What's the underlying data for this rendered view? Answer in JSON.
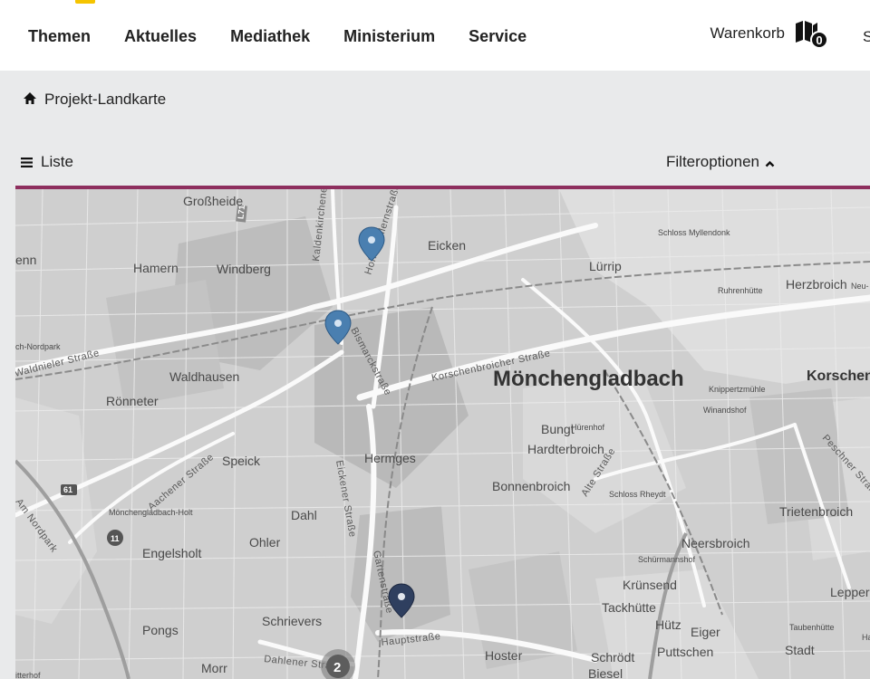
{
  "header": {
    "nav": [
      "Themen",
      "Aktuelles",
      "Mediathek",
      "Ministerium",
      "Service"
    ],
    "cart": {
      "label": "Warenkorb",
      "count": "0"
    },
    "cut_off_text": "S"
  },
  "breadcrumb": {
    "label": "Projekt-Landkarte"
  },
  "toolbar": {
    "list_label": "Liste",
    "filter_label": "Filteroptionen"
  },
  "colors": {
    "accent_line": "#8e2f5e",
    "marker_blue": "#4a7fb0",
    "marker_dark": "#2f3f5f",
    "page_bg": "#e9eaeb"
  },
  "map": {
    "city": "Mönchengladbach",
    "places": [
      "Großheide",
      "Eicken",
      "Hamern",
      "Windberg",
      "Lürrip",
      "Herzbroich",
      "Waldhausen",
      "Rönneter",
      "Bungt",
      "Hardterbroich",
      "Hermges",
      "Speick",
      "Bonnenbroich",
      "Dahl",
      "Ohler",
      "Engelsholt",
      "Trietenbroich",
      "Neersbroich",
      "Pongs",
      "Schrievers",
      "Tackhütte",
      "Hütz",
      "Eiger",
      "Krünsend",
      "Schrödt",
      "Puttschen",
      "Hoster",
      "Stadt",
      "Lepper",
      "Morr",
      "Biesel",
      "Korschen",
      "enn"
    ],
    "small_places": [
      "Schloss Myllendonk",
      "Ruhrenhütte",
      "Neu-",
      "Knippertzmühle",
      "Winandshof",
      "Hürenhof",
      "Schloss Rheydt",
      "Mönchengladbach-Holt",
      "Schürmannshof",
      "Taubenhütte",
      "Ha",
      "itterhof",
      "ch-Nordpark"
    ],
    "roads": [
      "Kaldenkirchener Straße",
      "Hohenzollernstraße",
      "Korschenbroicher Straße",
      "Waldnieler Straße",
      "Aachener Straße",
      "Eickener Straße",
      "Gartenstraße",
      "Hauptstraße",
      "Dahlener Straße",
      "Am Nordpark",
      "Alte Straße",
      "Peschner Straße",
      "Bismarckstraße"
    ],
    "shields": [
      "L71",
      "61",
      "11"
    ],
    "cluster_count": "2",
    "marker_count": 3
  }
}
